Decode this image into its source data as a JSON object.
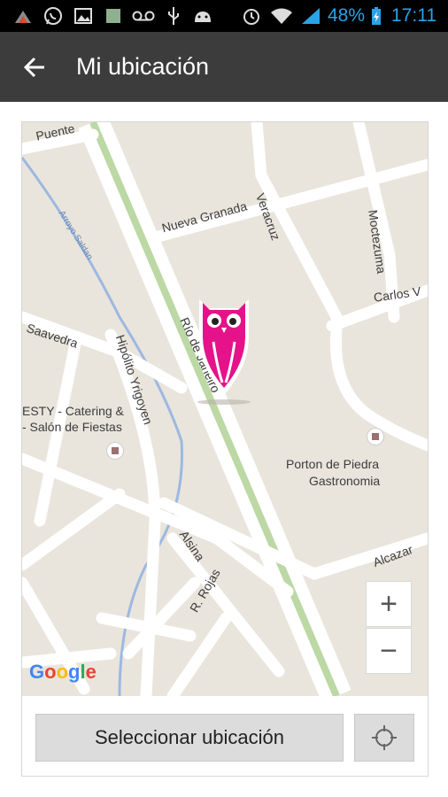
{
  "status_bar": {
    "battery": "48%",
    "time": "17:11",
    "icons": [
      "wifi-signal-icon",
      "whatsapp-icon",
      "gallery-icon",
      "app-icon",
      "voicemail-icon",
      "usb-icon",
      "android-icon",
      "alarm-icon",
      "wifi-icon",
      "cell-signal-icon",
      "battery-charging-icon"
    ]
  },
  "app_bar": {
    "title": "Mi ubicación",
    "back_icon": "arrow-back-icon"
  },
  "map": {
    "streets": {
      "puente": "Puente",
      "nueva_granada": "Nueva Granada",
      "veracruz": "Veracruz",
      "moctezuma": "Moctezuma",
      "carlos_v": "Carlos V",
      "saavedra": "Saavedra",
      "hipolito": "Hipólito Yrigoyen",
      "rio": "Río de Janeiro",
      "alsina": "Alsina",
      "rojas": "R. Rojas",
      "alcazar": "Alcazar",
      "arroyo": "Arroyo Saldan"
    },
    "poi": {
      "esty_line1": "ESTY - Catering &",
      "esty_line2": "- Salón de Fiestas",
      "porton_line1": "Porton de Piedra",
      "porton_line2": "Gastronomia"
    },
    "zoom_in": "+",
    "zoom_out": "−",
    "attribution": {
      "letters": [
        "G",
        "o",
        "o",
        "g",
        "l",
        "e"
      ],
      "colors": [
        "#4285f4",
        "#ea4335",
        "#fbbc05",
        "#4285f4",
        "#34a853",
        "#ea4335"
      ]
    },
    "marker_color": "#e5128a"
  },
  "actions": {
    "select_label": "Seleccionar ubicación",
    "locate_icon": "crosshair-icon"
  }
}
